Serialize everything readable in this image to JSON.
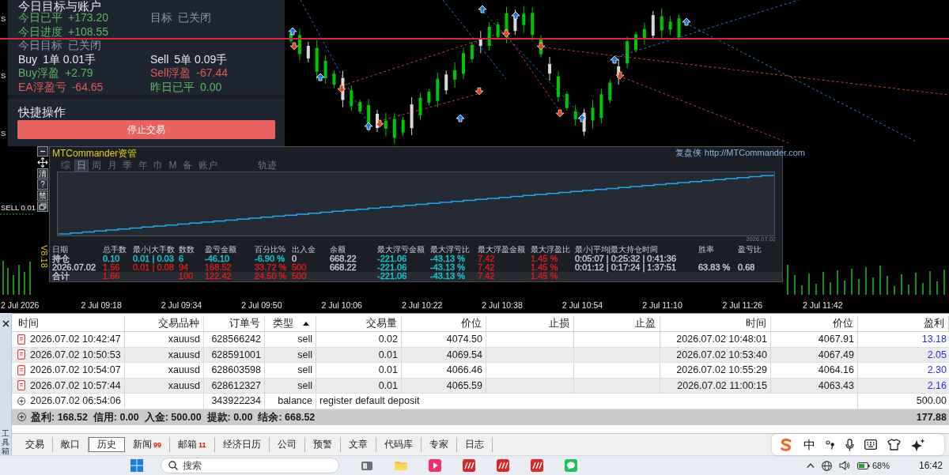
{
  "account_panel": {
    "title": "今日目标与账户",
    "rows": [
      [
        {
          "label": "今日已平",
          "value": "+173.20",
          "color": "#5cb860"
        },
        {
          "label": "目标",
          "value": "已关闭",
          "color": "#8d96a6"
        }
      ],
      [
        {
          "label": "今日进度",
          "value": "+108.55",
          "color": "#5cb860"
        }
      ],
      [
        {
          "label": "今日目标",
          "value": "已关闭",
          "color": "#8d96a6"
        }
      ],
      [
        {
          "label": "Buy",
          "value": "1单 0.01手",
          "color": "#e6e8ec"
        },
        {
          "label": "Sell",
          "value": "5单 0.09手",
          "color": "#e6e8ec"
        }
      ],
      [
        {
          "label": "Buy浮盈",
          "value": "+2.79",
          "color": "#5cb860"
        },
        {
          "label": "Sell浮盈",
          "value": "-67.44",
          "color": "#e35d58"
        }
      ],
      [
        {
          "label": "EA浮盈亏",
          "value": "-64.65",
          "color": "#e35d58"
        },
        {
          "label": "昨日已平",
          "value": "0.00",
          "color": "#5cb860"
        }
      ]
    ],
    "section_title": "快捷操作",
    "button": "停止交易"
  },
  "chart": {
    "edge_labels": [
      "S",
      "S",
      "S"
    ],
    "order_label": "SELL 0.01",
    "vertical_label": "V8.18"
  },
  "tool_buttons": [
    {
      "kind": "minimize"
    },
    {
      "kind": "move"
    },
    {
      "kind": "label",
      "label": "清"
    },
    {
      "kind": "label",
      "label": "?"
    },
    {
      "kind": "label",
      "label": "禁"
    },
    {
      "kind": "restore"
    }
  ],
  "stats_window": {
    "title": "MTCommander资管",
    "author": "复盘侠",
    "link": "http://MTCommander.com",
    "tabs": [
      {
        "label": "综",
        "selected": false
      },
      {
        "label": "日",
        "selected": true
      },
      {
        "label": "周",
        "selected": false
      },
      {
        "label": "月",
        "selected": false
      },
      {
        "label": "季",
        "selected": false
      },
      {
        "label": "年",
        "selected": false
      },
      {
        "label": "巾",
        "selected": false
      },
      {
        "label": "M",
        "selected": false
      },
      {
        "label": "备",
        "selected": false
      },
      {
        "label": "账户",
        "selected": false
      }
    ],
    "trail_tab": {
      "label": "轨迹",
      "selected": false
    },
    "curve_date": "2026.07.02",
    "columns": [
      "日期",
      "总手数",
      "最小|大手数",
      "数数",
      "盈亏金额",
      "百分比%",
      "出入金",
      "余额",
      "最大浮亏金额",
      "最大浮亏比",
      "最大浮盈金额",
      "最大浮盈比",
      "最小|平均|最大持仓时间",
      "胜率",
      "盈亏比"
    ],
    "rows": [
      {
        "kind": "period",
        "cells": [
          {
            "text": "持仓",
            "color": "#c3c7cf"
          },
          {
            "text": "0.10",
            "color": "#19c3d2"
          },
          {
            "text": "0.01 | 0.03",
            "color": "#19c3d2"
          },
          {
            "text": "6",
            "color": "#19c3d2"
          },
          {
            "text": "-46.10",
            "color": "#19c3d2"
          },
          {
            "text": "-6.90 %",
            "color": "#19c3d2"
          },
          {
            "text": "0",
            "color": "#c3c7cf"
          },
          {
            "text": "668.22",
            "color": "#c3c7cf"
          },
          {
            "text": "-221.06",
            "color": "#19c3d2"
          },
          {
            "text": "-43.13 %",
            "color": "#19c3d2"
          },
          {
            "text": "7.42",
            "color": "#d61e1e"
          },
          {
            "text": "1.45 %",
            "color": "#d61e1e"
          },
          {
            "text": "0:05:07 | 0:25:32 | 0:41:36",
            "color": "#c3c7cf"
          },
          null,
          null
        ]
      },
      {
        "kind": "period",
        "cells": [
          {
            "text": "2026.07.02",
            "color": "#c3c7cf"
          },
          {
            "text": "1.56",
            "color": "#d61e1e"
          },
          {
            "text": "0.01 | 0.08",
            "color": "#d61e1e"
          },
          {
            "text": "94",
            "color": "#d61e1e"
          },
          {
            "text": "168.52",
            "color": "#d61e1e"
          },
          {
            "text": "33.72 %",
            "color": "#d61e1e"
          },
          {
            "text": "500",
            "color": "#d61e1e"
          },
          {
            "text": "668.22",
            "color": "#c3c7cf"
          },
          {
            "text": "-221.06",
            "color": "#19c3d2"
          },
          {
            "text": "-43.13 %",
            "color": "#19c3d2"
          },
          {
            "text": "7.42",
            "color": "#d61e1e"
          },
          {
            "text": "1.45 %",
            "color": "#d61e1e"
          },
          {
            "text": "0:01:12 | 0:17:24 | 1:37:51",
            "color": "#c3c7cf"
          },
          {
            "text": "63.83 %",
            "color": "#c3c7cf"
          },
          {
            "text": "0.68",
            "color": "#c3c7cf"
          }
        ]
      },
      {
        "kind": "total",
        "cells": [
          {
            "text": "合计",
            "color": "#c3c7cf"
          },
          {
            "text": "1.66",
            "color": "#d61e1e"
          },
          null,
          {
            "text": "100",
            "color": "#d61e1e"
          },
          {
            "text": "122.42",
            "color": "#d61e1e"
          },
          {
            "text": "24.50 %",
            "color": "#d61e1e"
          },
          {
            "text": "500",
            "color": "#d61e1e"
          },
          null,
          {
            "text": "-221.06",
            "color": "#19c3d2"
          },
          {
            "text": "-43.13 %",
            "color": "#19c3d2"
          },
          {
            "text": "7.42",
            "color": "#d61e1e"
          },
          {
            "text": "1.45 %",
            "color": "#d61e1e"
          },
          null,
          null,
          null
        ]
      }
    ]
  },
  "time_axis": [
    "2 Jul 2026",
    "2 Jul 09:18",
    "2 Jul 09:34",
    "2 Jul 09:50",
    "2 Jul 10:06",
    "2 Jul 10:22",
    "2 Jul 10:38",
    "2 Jul 10:54",
    "2 Jul 11:10",
    "2 Jul 11:26",
    "2 Jul 11:42"
  ],
  "history": {
    "columns": [
      {
        "label": "时间",
        "sorted": false
      },
      {
        "label": "交易品种",
        "sorted": false
      },
      {
        "label": "订单号",
        "sorted": false
      },
      {
        "label": "类型",
        "sorted": true
      },
      {
        "label": "交易量",
        "sorted": false
      },
      {
        "label": "价位",
        "sorted": false
      },
      {
        "label": "止损",
        "sorted": false
      },
      {
        "label": "止盈",
        "sorted": false
      },
      {
        "label": "时间",
        "sorted": false
      },
      {
        "label": "价位",
        "sorted": false
      },
      {
        "label": "盈利",
        "sorted": false
      }
    ],
    "rows": [
      {
        "kind": "order",
        "time": "2026.07.02 10:42:47",
        "symbol": "xauusd",
        "ticket": "628566242",
        "type": "sell",
        "volume": "0.02",
        "price": "4074.50",
        "close_time": "2026.07.02 10:48:01",
        "close_price": "4067.91",
        "profit": "13.18"
      },
      {
        "kind": "order",
        "time": "2026.07.02 10:50:53",
        "symbol": "xauusd",
        "ticket": "628591001",
        "type": "sell",
        "volume": "0.01",
        "price": "4069.54",
        "close_time": "2026.07.02 10:53:40",
        "close_price": "4067.49",
        "profit": "2.05"
      },
      {
        "kind": "order",
        "time": "2026.07.02 10:54:07",
        "symbol": "xauusd",
        "ticket": "628603598",
        "type": "sell",
        "volume": "0.01",
        "price": "4066.46",
        "close_time": "2026.07.02 10:55:29",
        "close_price": "4064.16",
        "profit": "2.30"
      },
      {
        "kind": "order",
        "time": "2026.07.02 10:57:44",
        "symbol": "xauusd",
        "ticket": "628612327",
        "type": "sell",
        "volume": "0.01",
        "price": "4065.59",
        "close_time": "2026.07.02 11:00:15",
        "close_price": "4063.43",
        "profit": "2.16"
      },
      {
        "kind": "balance",
        "time": "2026.07.02 06:54:06",
        "ticket": "343922234",
        "type": "balance",
        "comment": "register default deposit",
        "profit": "500.00"
      }
    ],
    "summary": {
      "text": "盈利: 168.52  信用: 0.00  入金: 500.00  提款: 0.00  结余: 668.52",
      "total": "177.88"
    }
  },
  "toolbox_label": "工具箱",
  "bottom_tabs": [
    {
      "label": "交易",
      "selected": false
    },
    {
      "label": "敞口",
      "selected": false
    },
    {
      "label": "历史",
      "selected": true
    },
    {
      "label": "新闻",
      "badge": "99",
      "selected": false
    },
    {
      "label": "邮箱",
      "badge": "11",
      "selected": false
    },
    {
      "label": "经济日历",
      "selected": false
    },
    {
      "label": "公司",
      "selected": false
    },
    {
      "label": "预警",
      "selected": false
    },
    {
      "label": "文章",
      "selected": false
    },
    {
      "label": "代码库",
      "selected": false
    },
    {
      "label": "专家",
      "selected": false
    },
    {
      "label": "日志",
      "selected": false
    }
  ],
  "ime_toolbar": {
    "mode": "中"
  },
  "taskbar": {
    "search_placeholder": "搜索",
    "battery": "68%",
    "clock": "16:42"
  }
}
